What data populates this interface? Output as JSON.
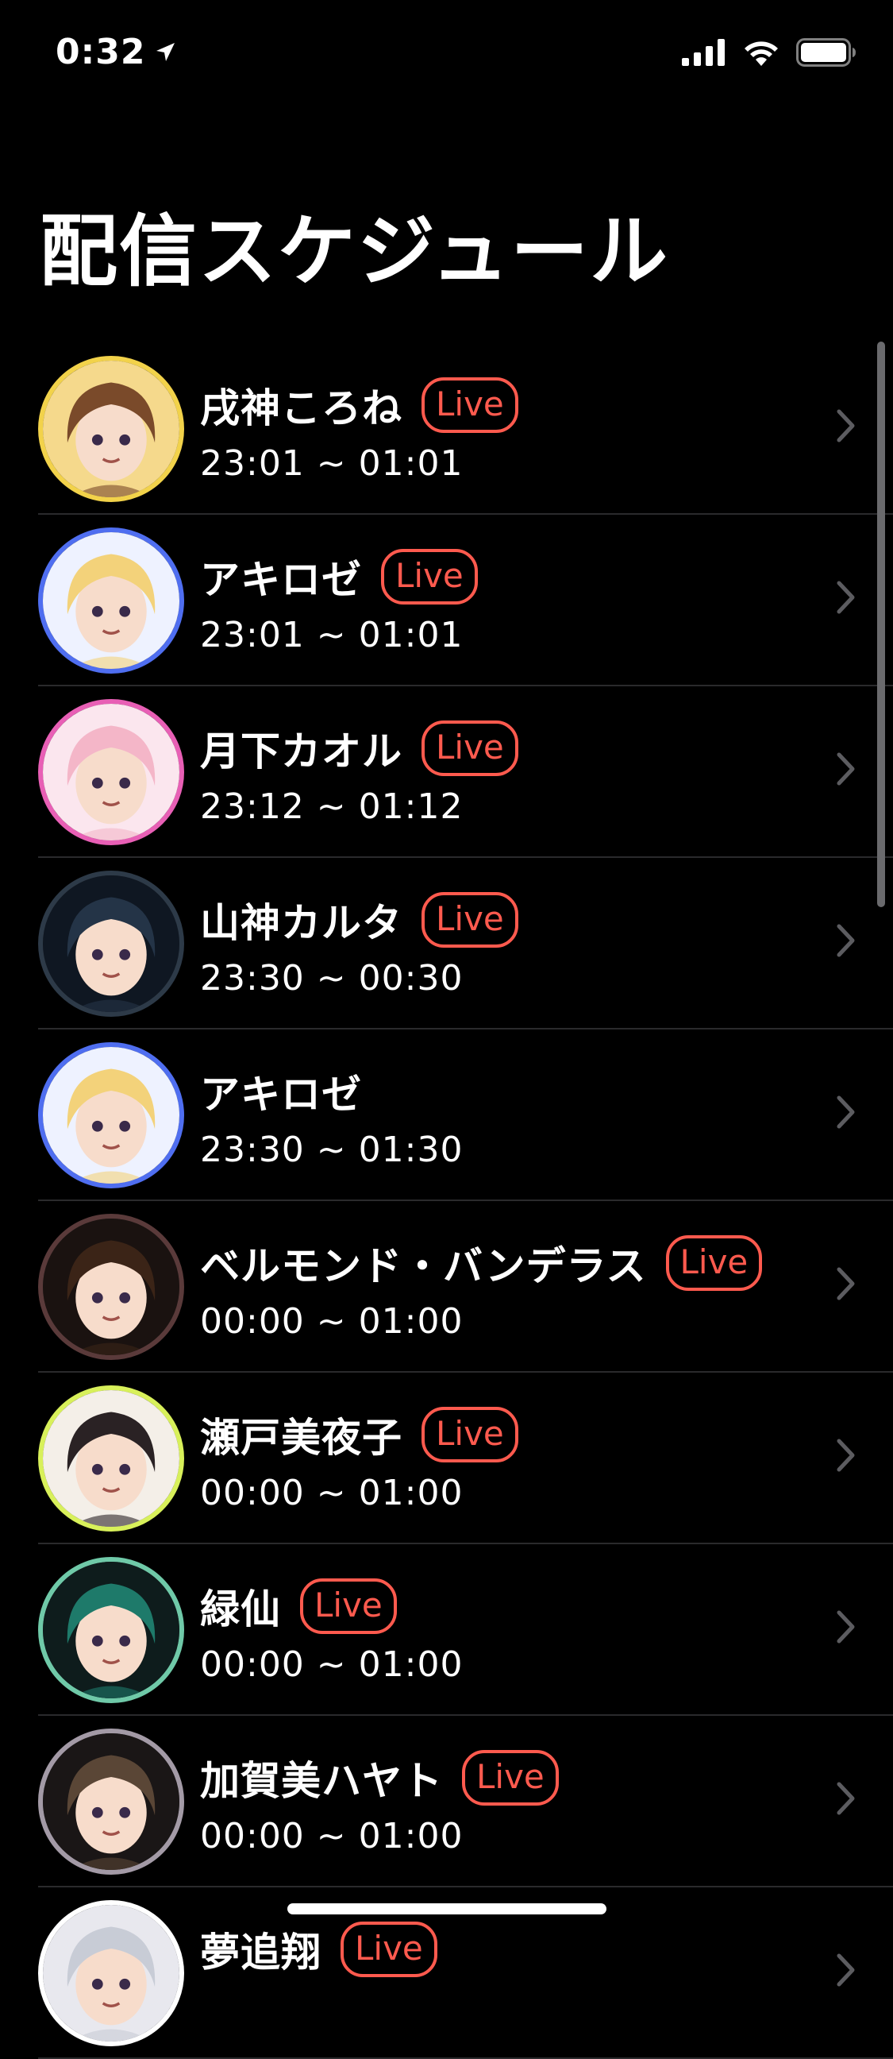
{
  "status_bar": {
    "time": "0:32"
  },
  "title": "配信スケジュール",
  "live_label": "Live",
  "colors": {
    "live": "#ff5a4e",
    "background": "#000000",
    "separator": "#2a2a2c"
  },
  "rows": [
    {
      "name": "戌神ころね",
      "time": "23:01 ~ 01:01",
      "live": true,
      "ring": "#f2d24a",
      "hair": "#7a4a2a",
      "bg": "#f5d98c"
    },
    {
      "name": "アキロゼ",
      "time": "23:01 ~ 01:01",
      "live": true,
      "ring": "#4f6ef0",
      "hair": "#f3d27a",
      "bg": "#eef2ff"
    },
    {
      "name": "月下カオル",
      "time": "23:12 ~ 01:12",
      "live": true,
      "ring": "#e85fb5",
      "hair": "#f4b6c8",
      "bg": "#fbe6ee"
    },
    {
      "name": "山神カルタ",
      "time": "23:30 ~ 00:30",
      "live": true,
      "ring": "#2d3a48",
      "hair": "#243447",
      "bg": "#0f1722"
    },
    {
      "name": "アキロゼ",
      "time": "23:30 ~ 01:30",
      "live": false,
      "ring": "#4f6ef0",
      "hair": "#f3d27a",
      "bg": "#eef2ff"
    },
    {
      "name": "ベルモンド・バンデラス",
      "time": "00:00 ~ 01:00",
      "live": true,
      "ring": "#5a3a3a",
      "hair": "#3b2417",
      "bg": "#1a1210"
    },
    {
      "name": "瀬戸美夜子",
      "time": "00:00 ~ 01:00",
      "live": true,
      "ring": "#d8f05a",
      "hair": "#2a2224",
      "bg": "#f4efe8"
    },
    {
      "name": "緑仙",
      "time": "00:00 ~ 01:00",
      "live": true,
      "ring": "#6fc9a8",
      "hair": "#1e7a6a",
      "bg": "#0e1c1c"
    },
    {
      "name": "加賀美ハヤト",
      "time": "00:00 ~ 01:00",
      "live": true,
      "ring": "#a39aa6",
      "hair": "#5a4636",
      "bg": "#1a1616"
    },
    {
      "name": "夢追翔",
      "time": "",
      "live": true,
      "ring": "#ffffff",
      "hair": "#c8ccd6",
      "bg": "#e8e8ee"
    }
  ]
}
